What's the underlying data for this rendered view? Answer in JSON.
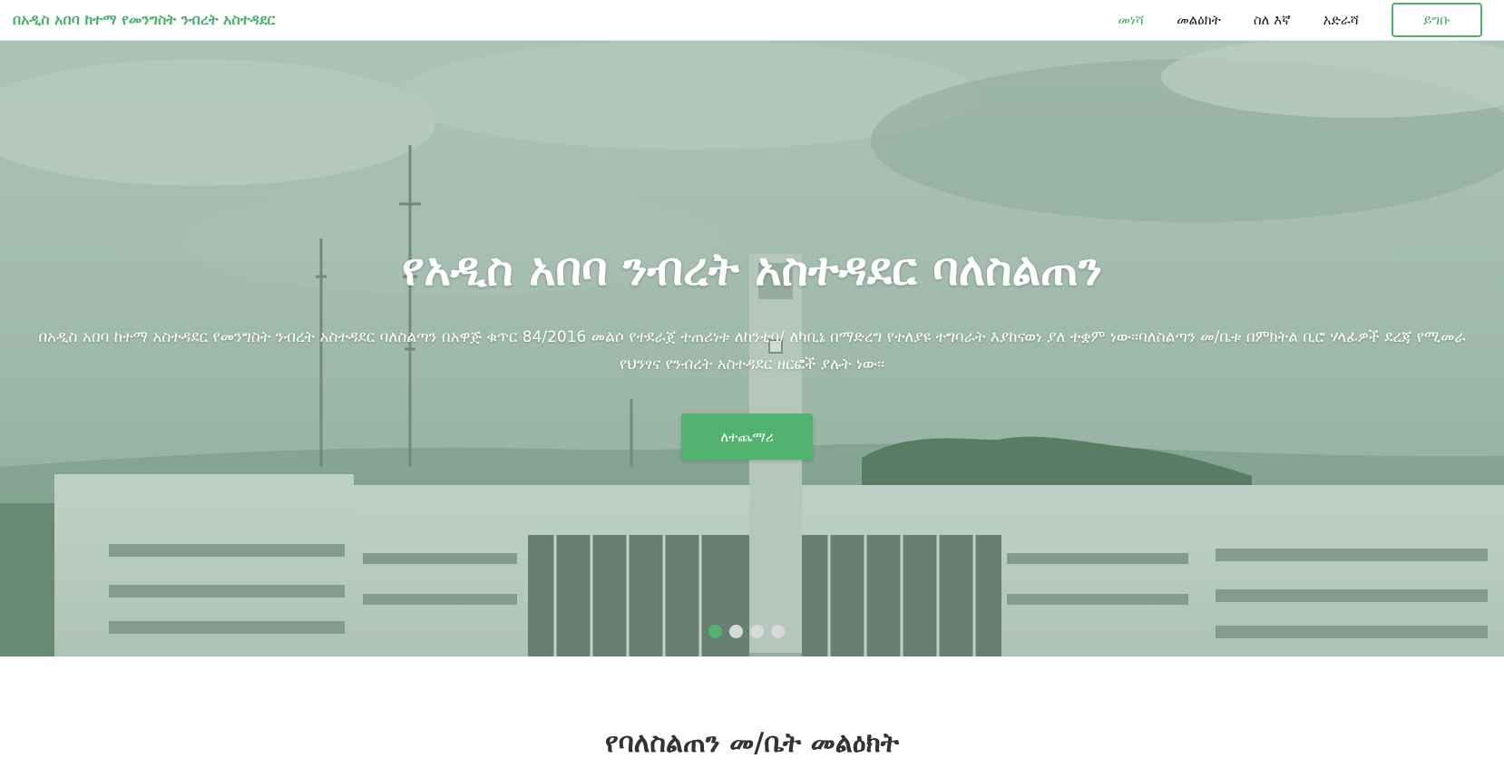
{
  "header": {
    "brand": "በአዲስ አበባ ከተማ የመንግስት ንብረት አስተዳደር",
    "nav": [
      {
        "label": "መነሻ",
        "active": true
      },
      {
        "label": "መልዕክት",
        "active": false
      },
      {
        "label": "ስለ እኛ",
        "active": false
      },
      {
        "label": "አድራሻ",
        "active": false
      }
    ],
    "login_label": "ይግቡ"
  },
  "hero": {
    "title": "የአዲስ አበባ ንብረት አስተዳደር ባለስልጠን",
    "description": "በአዲስ አበባ ከተማ አስተዳደር የመንግስት ንብረት አስተዳደር ባለስልጣን በአዋጅ ቁጥር 84/2016 መልሶ የተደራጀ ተጠሪነቱ ለከንቲባ/ ለካቢኔ በማድረግ የተለያዩ ተግባራት እያከናወነ ያለ ተቋም ነው፡፡ባለስልጣን መ/ቤቱ በምክትል ቢሮ ሃላፊዎች ደረጃ የሚመራ የህንፃና የንብረት አስተዳደር ዘርፎች ያሉት ነው፡፡",
    "more_label": "ለተጨማሪ",
    "slides": 4,
    "active_slide": 1
  },
  "section": {
    "title": "የባለስልጠን መ/ቤት መልዕክት"
  },
  "colors": {
    "accent": "#52b26f",
    "brand": "#4caf6f"
  }
}
